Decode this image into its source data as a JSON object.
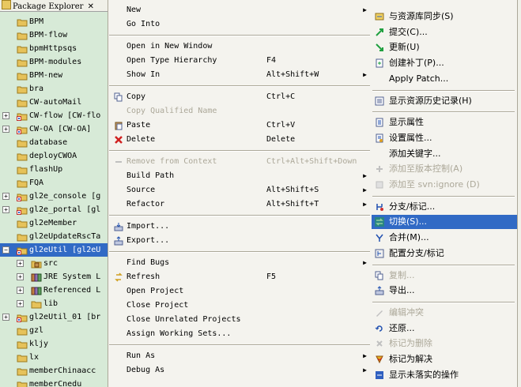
{
  "explorer": {
    "title": "Package Explorer",
    "items": [
      {
        "label": "BPM",
        "indent": 0,
        "expander": "",
        "icon": "folder"
      },
      {
        "label": "BPM-flow",
        "indent": 0,
        "expander": "",
        "icon": "folder"
      },
      {
        "label": "bpmHttpsqs",
        "indent": 0,
        "expander": "",
        "icon": "folder"
      },
      {
        "label": "BPM-modules",
        "indent": 0,
        "expander": "",
        "icon": "folder"
      },
      {
        "label": "BPM-new",
        "indent": 0,
        "expander": "",
        "icon": "folder"
      },
      {
        "label": "bra",
        "indent": 0,
        "expander": "",
        "icon": "folder"
      },
      {
        "label": "CW-autoMail",
        "indent": 0,
        "expander": "",
        "icon": "folder"
      },
      {
        "label": "CW-flow [CW-flo",
        "indent": 0,
        "expander": "+",
        "icon": "project"
      },
      {
        "label": "CW-OA [CW-OA]",
        "indent": 0,
        "expander": "+",
        "icon": "project"
      },
      {
        "label": "database",
        "indent": 0,
        "expander": "",
        "icon": "folder"
      },
      {
        "label": "deployCWOA",
        "indent": 0,
        "expander": "",
        "icon": "folder"
      },
      {
        "label": "flashUp",
        "indent": 0,
        "expander": "",
        "icon": "folder"
      },
      {
        "label": "FQA",
        "indent": 0,
        "expander": "",
        "icon": "folder"
      },
      {
        "label": "gl2e_console [g",
        "indent": 0,
        "expander": "+",
        "icon": "project"
      },
      {
        "label": "gl2e_portal [gl",
        "indent": 0,
        "expander": "+",
        "icon": "project"
      },
      {
        "label": "gl2eMember",
        "indent": 0,
        "expander": "",
        "icon": "folder"
      },
      {
        "label": "gl2eUpdateRscTa",
        "indent": 0,
        "expander": "",
        "icon": "folder"
      },
      {
        "label": "gl2eUtil [gl2eU",
        "indent": 0,
        "expander": "-",
        "icon": "project",
        "selected": true
      },
      {
        "label": "src",
        "indent": 1,
        "expander": "+",
        "icon": "package"
      },
      {
        "label": "JRE System L",
        "indent": 1,
        "expander": "+",
        "icon": "library"
      },
      {
        "label": "Referenced L",
        "indent": 1,
        "expander": "+",
        "icon": "library"
      },
      {
        "label": "lib",
        "indent": 1,
        "expander": "+",
        "icon": "folder"
      },
      {
        "label": "gl2eUtil_01 [br",
        "indent": 0,
        "expander": "+",
        "icon": "project"
      },
      {
        "label": "gzl",
        "indent": 0,
        "expander": "",
        "icon": "folder"
      },
      {
        "label": "kljy",
        "indent": 0,
        "expander": "",
        "icon": "folder"
      },
      {
        "label": "lx",
        "indent": 0,
        "expander": "",
        "icon": "folder"
      },
      {
        "label": "memberChinaacc",
        "indent": 0,
        "expander": "",
        "icon": "folder"
      },
      {
        "label": "memberCnedu",
        "indent": 0,
        "expander": "",
        "icon": "folder"
      }
    ]
  },
  "context_menu": {
    "items": [
      {
        "label": "New",
        "shortcut": "",
        "arrow": "▶",
        "icon": "",
        "disabled": false
      },
      {
        "label": "Go Into",
        "shortcut": "",
        "arrow": "",
        "icon": "",
        "disabled": false
      },
      {
        "sep": true
      },
      {
        "label": "Open in New Window",
        "shortcut": "",
        "arrow": "",
        "icon": "",
        "disabled": false
      },
      {
        "label": "Open Type Hierarchy",
        "shortcut": "F4",
        "arrow": "",
        "icon": "",
        "disabled": false
      },
      {
        "label": "Show In",
        "shortcut": "Alt+Shift+W",
        "arrow": "▶",
        "icon": "",
        "disabled": false
      },
      {
        "sep": true
      },
      {
        "label": "Copy",
        "shortcut": "Ctrl+C",
        "arrow": "",
        "icon": "copy",
        "disabled": false
      },
      {
        "label": "Copy Qualified Name",
        "shortcut": "",
        "arrow": "",
        "icon": "",
        "disabled": true
      },
      {
        "label": "Paste",
        "shortcut": "Ctrl+V",
        "arrow": "",
        "icon": "paste",
        "disabled": false
      },
      {
        "label": "Delete",
        "shortcut": "Delete",
        "arrow": "",
        "icon": "delete",
        "disabled": false
      },
      {
        "sep": true
      },
      {
        "label": "Remove from Context",
        "shortcut": "Ctrl+Alt+Shift+Down",
        "arrow": "",
        "icon": "remove",
        "disabled": true
      },
      {
        "label": "Build Path",
        "shortcut": "",
        "arrow": "▶",
        "icon": "",
        "disabled": false
      },
      {
        "label": "Source",
        "shortcut": "Alt+Shift+S",
        "arrow": "▶",
        "icon": "",
        "disabled": false
      },
      {
        "label": "Refactor",
        "shortcut": "Alt+Shift+T",
        "arrow": "▶",
        "icon": "",
        "disabled": false
      },
      {
        "sep": true
      },
      {
        "label": "Import...",
        "shortcut": "",
        "arrow": "",
        "icon": "import",
        "disabled": false
      },
      {
        "label": "Export...",
        "shortcut": "",
        "arrow": "",
        "icon": "export",
        "disabled": false
      },
      {
        "sep": true
      },
      {
        "label": "Find Bugs",
        "shortcut": "",
        "arrow": "▶",
        "icon": "",
        "disabled": false
      },
      {
        "label": "Refresh",
        "shortcut": "F5",
        "arrow": "",
        "icon": "refresh",
        "disabled": false
      },
      {
        "label": "Open Project",
        "shortcut": "",
        "arrow": "",
        "icon": "",
        "disabled": false
      },
      {
        "label": "Close Project",
        "shortcut": "",
        "arrow": "",
        "icon": "",
        "disabled": false
      },
      {
        "label": "Close Unrelated Projects",
        "shortcut": "",
        "arrow": "",
        "icon": "",
        "disabled": false
      },
      {
        "label": "Assign Working Sets...",
        "shortcut": "",
        "arrow": "",
        "icon": "",
        "disabled": false
      },
      {
        "sep": true
      },
      {
        "label": "Run As",
        "shortcut": "",
        "arrow": "▶",
        "icon": "",
        "disabled": false
      },
      {
        "label": "Debug As",
        "shortcut": "",
        "arrow": "▶",
        "icon": "",
        "disabled": false
      }
    ]
  },
  "team_submenu": {
    "items": [
      {
        "label": "与资源库同步(S)",
        "icon": "sync",
        "disabled": false
      },
      {
        "label": "提交(C)...",
        "icon": "commit",
        "disabled": false
      },
      {
        "label": "更新(U)",
        "icon": "update",
        "disabled": false
      },
      {
        "label": "创建补丁(P)...",
        "icon": "patch",
        "disabled": false
      },
      {
        "label": "Apply Patch...",
        "icon": "",
        "disabled": false
      },
      {
        "sep": true
      },
      {
        "label": "显示资源历史记录(H)",
        "icon": "history",
        "disabled": false
      },
      {
        "sep": true
      },
      {
        "label": "显示属性",
        "icon": "properties",
        "disabled": false
      },
      {
        "label": "设置属性...",
        "icon": "set-properties",
        "disabled": false
      },
      {
        "label": "添加关键字...",
        "icon": "",
        "disabled": false
      },
      {
        "label": "添加至版本控制(A)",
        "icon": "add",
        "disabled": true
      },
      {
        "label": "添加至 svn:ignore (D)",
        "icon": "ignore",
        "disabled": true
      },
      {
        "sep": true
      },
      {
        "label": "分支/标记...",
        "icon": "branch",
        "disabled": false
      },
      {
        "label": "切换(S)...",
        "icon": "switch",
        "disabled": false,
        "highlight": true
      },
      {
        "label": "合并(M)...",
        "icon": "merge",
        "disabled": false
      },
      {
        "label": "配置分支/标记",
        "icon": "config-branch",
        "disabled": false
      },
      {
        "sep": true
      },
      {
        "label": "复制...",
        "icon": "copy",
        "disabled": true
      },
      {
        "label": "导出...",
        "icon": "export",
        "disabled": false
      },
      {
        "sep": true
      },
      {
        "label": "编辑冲突",
        "icon": "edit-conflict",
        "disabled": true
      },
      {
        "label": "还原...",
        "icon": "revert",
        "disabled": false
      },
      {
        "label": "标记为删除",
        "icon": "mark-delete",
        "disabled": true
      },
      {
        "label": "标记为解决",
        "icon": "mark-resolved",
        "disabled": false
      },
      {
        "label": "显示未落实的操作",
        "icon": "show-pending",
        "disabled": false
      }
    ]
  },
  "colors": {
    "selection": "#316ac5",
    "menu_bg": "#f4f3ee",
    "explorer_bg": "#d7ead7",
    "disabled": "#aca899"
  }
}
